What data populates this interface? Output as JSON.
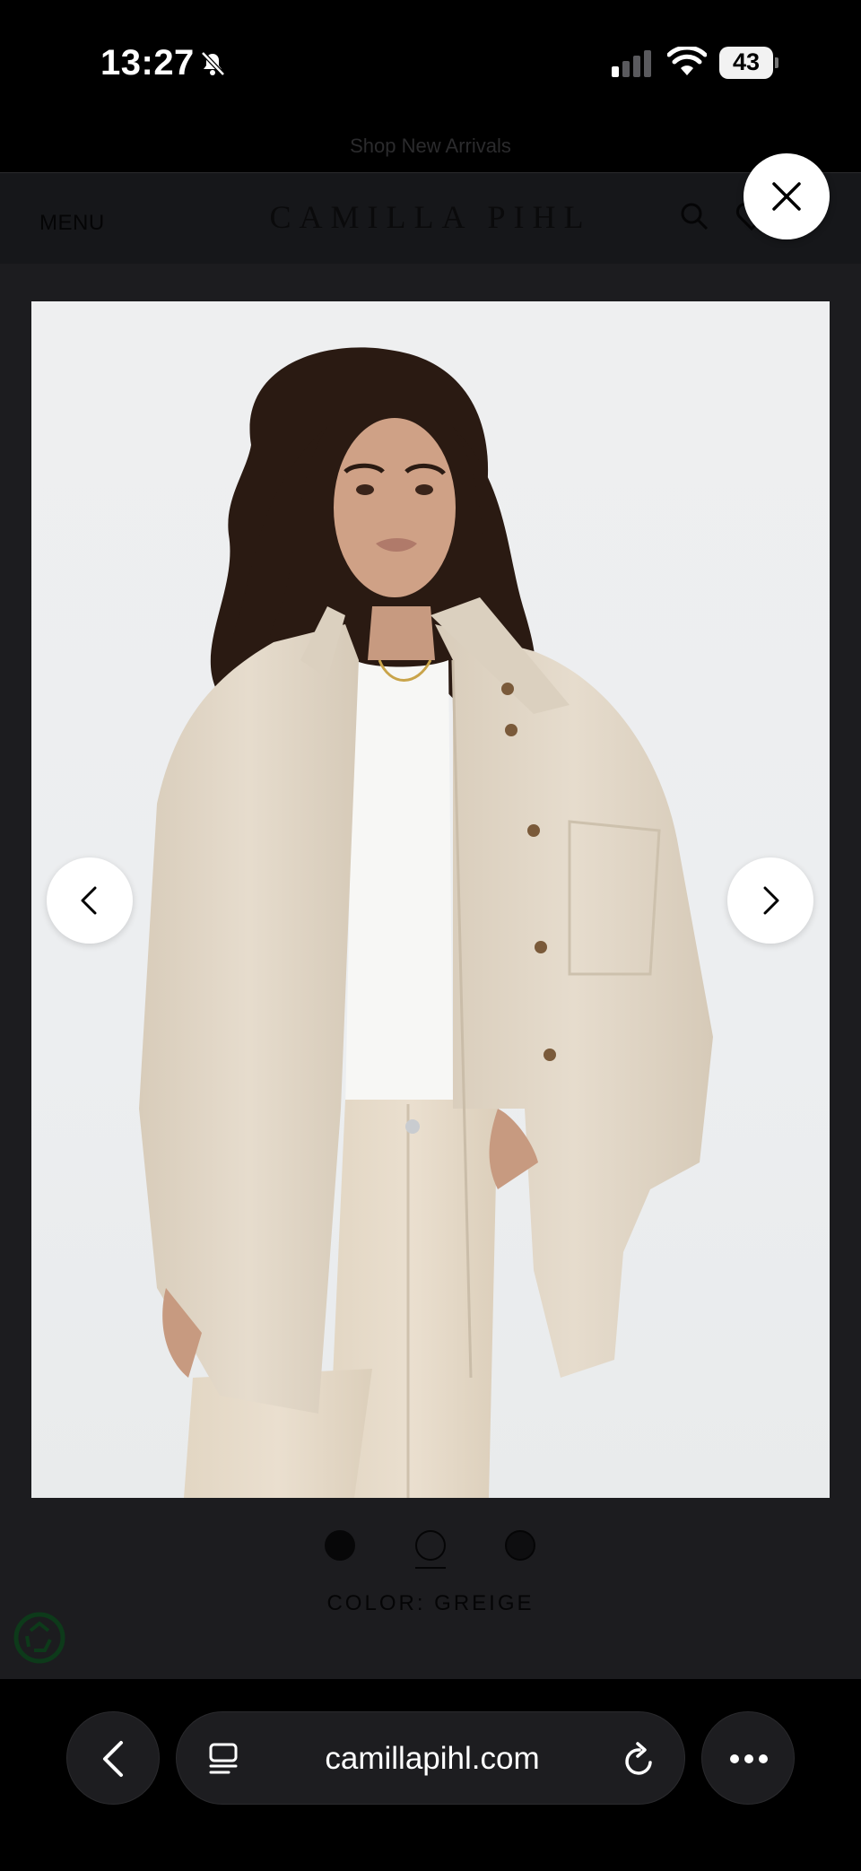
{
  "status_bar": {
    "time": "13:27",
    "battery_level": "43",
    "icons": [
      "bell-slash-icon",
      "cellular-signal-icon",
      "wifi-icon",
      "battery-icon"
    ]
  },
  "announcement": {
    "text": "Shop New Arrivals"
  },
  "header": {
    "menu_label": "MENU",
    "brand": "CAMILLA PIHL",
    "icons": [
      "search-icon",
      "wishlist-icon"
    ]
  },
  "gallery": {
    "close_icon": "close-icon",
    "prev_icon": "chevron-left-icon",
    "next_icon": "chevron-right-icon",
    "image_subject": "model wearing greige oversized denim shirt over white tee with matching jeans",
    "slide_count": 3,
    "active_slide": 2,
    "colors": {
      "shirt": "#e3d8c8",
      "background": "#eceef0",
      "hair": "#2a1a12"
    }
  },
  "product": {
    "color_label": "COLOR: GREIGE"
  },
  "browser": {
    "url": "camillapihl.com",
    "icons": [
      "back-arrow-icon",
      "tabs-icon",
      "reload-icon",
      "more-icon"
    ]
  },
  "theme": {
    "overlay": "#1b1b1d",
    "status_bar": "#000000",
    "button_bg": "#ffffff"
  }
}
